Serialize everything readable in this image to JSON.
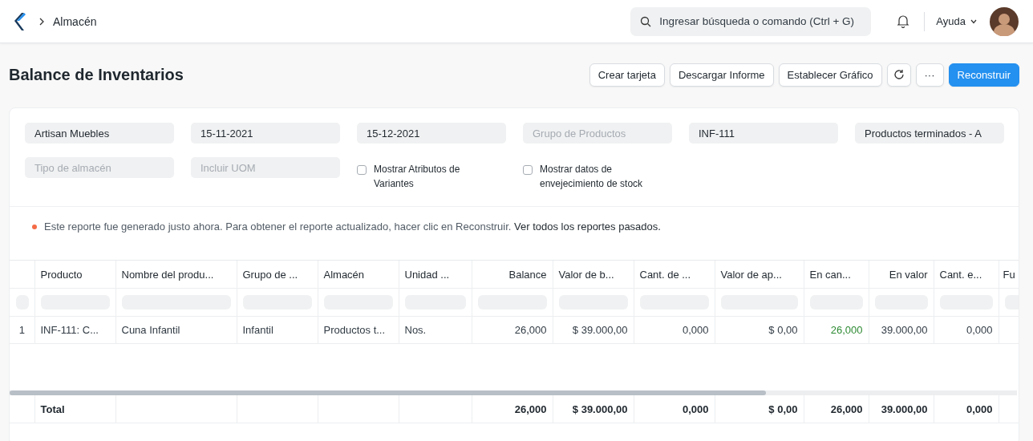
{
  "navbar": {
    "breadcrumb": "Almacén",
    "search": {
      "placeholder": "Ingresar búsqueda o comando (Ctrl + G)"
    },
    "help": "Ayuda"
  },
  "page": {
    "title": "Balance de Inventarios",
    "buttons": [
      {
        "label": "Crear tarjeta",
        "kind": "default"
      },
      {
        "label": "Descargar Informe",
        "kind": "default"
      },
      {
        "label": "Establecer Gráfico",
        "kind": "default"
      },
      {
        "kind": "refresh"
      },
      {
        "label": "···",
        "kind": "default"
      },
      {
        "label": "Reconstruir",
        "kind": "primary"
      }
    ]
  },
  "filters": [
    {
      "kind": "field",
      "value": "Artisan Muebles"
    },
    {
      "kind": "field",
      "value": "15-11-2021"
    },
    {
      "kind": "field",
      "value": "15-12-2021"
    },
    {
      "kind": "field",
      "placeholder": "Grupo de Productos"
    },
    {
      "kind": "field",
      "value": "INF-111"
    },
    {
      "kind": "field",
      "value": "Productos terminados - A"
    },
    {
      "kind": "field",
      "placeholder": "Tipo de almacén"
    },
    {
      "kind": "field",
      "placeholder": "Incluir UOM"
    },
    {
      "kind": "checkbox",
      "label": "Mostrar Atributos de Variantes",
      "checked": false
    },
    {
      "kind": "checkbox",
      "label": "Mostrar datos de envejecimiento de stock",
      "checked": false
    }
  ],
  "notice": {
    "text": "Este reporte fue generado justo ahora. Para obtener el reporte actualizado, hacer clic en Reconstruir.",
    "link": "Ver todos los reportes pasados."
  },
  "table": {
    "columns": [
      {
        "label": "Producto",
        "kind": "text"
      },
      {
        "label": "Nombre del produ...",
        "kind": "text"
      },
      {
        "label": "Grupo de ...",
        "kind": "text"
      },
      {
        "label": "Almacén",
        "kind": "text"
      },
      {
        "label": "Unidad ...",
        "kind": "text"
      },
      {
        "label": "Balance",
        "kind": "number"
      },
      {
        "label": "Valor de b...",
        "kind": "text"
      },
      {
        "label": "Cant. de ...",
        "kind": "text"
      },
      {
        "label": "Valor de ap...",
        "kind": "text"
      },
      {
        "label": "En can...",
        "kind": "text"
      },
      {
        "label": "En valor",
        "kind": "number"
      },
      {
        "label": "Cant. e...",
        "kind": "text"
      },
      {
        "label": "Fu",
        "kind": "text"
      }
    ],
    "rows": [
      {
        "index": "1",
        "cells": [
          {
            "text": "INF-111: C...",
            "positive": false
          },
          {
            "text": "Cuna Infantil",
            "positive": false
          },
          {
            "text": "Infantil",
            "positive": false
          },
          {
            "text": "Productos t...",
            "positive": false
          },
          {
            "text": "Nos.",
            "positive": false
          },
          {
            "text": "26,000",
            "positive": false
          },
          {
            "text": "$ 39.000,00",
            "positive": false
          },
          {
            "text": "0,000",
            "positive": false
          },
          {
            "text": "$ 0,00",
            "positive": false
          },
          {
            "text": "26,000",
            "positive": true
          },
          {
            "text": "39.000,00",
            "positive": false
          },
          {
            "text": "0,000",
            "positive": false
          }
        ]
      }
    ],
    "total": {
      "label": "Total",
      "values": [
        "26,000",
        "$ 39.000,00",
        "0,000",
        "$ 0,00",
        "26,000",
        "39.000,00",
        "0,000"
      ]
    }
  }
}
